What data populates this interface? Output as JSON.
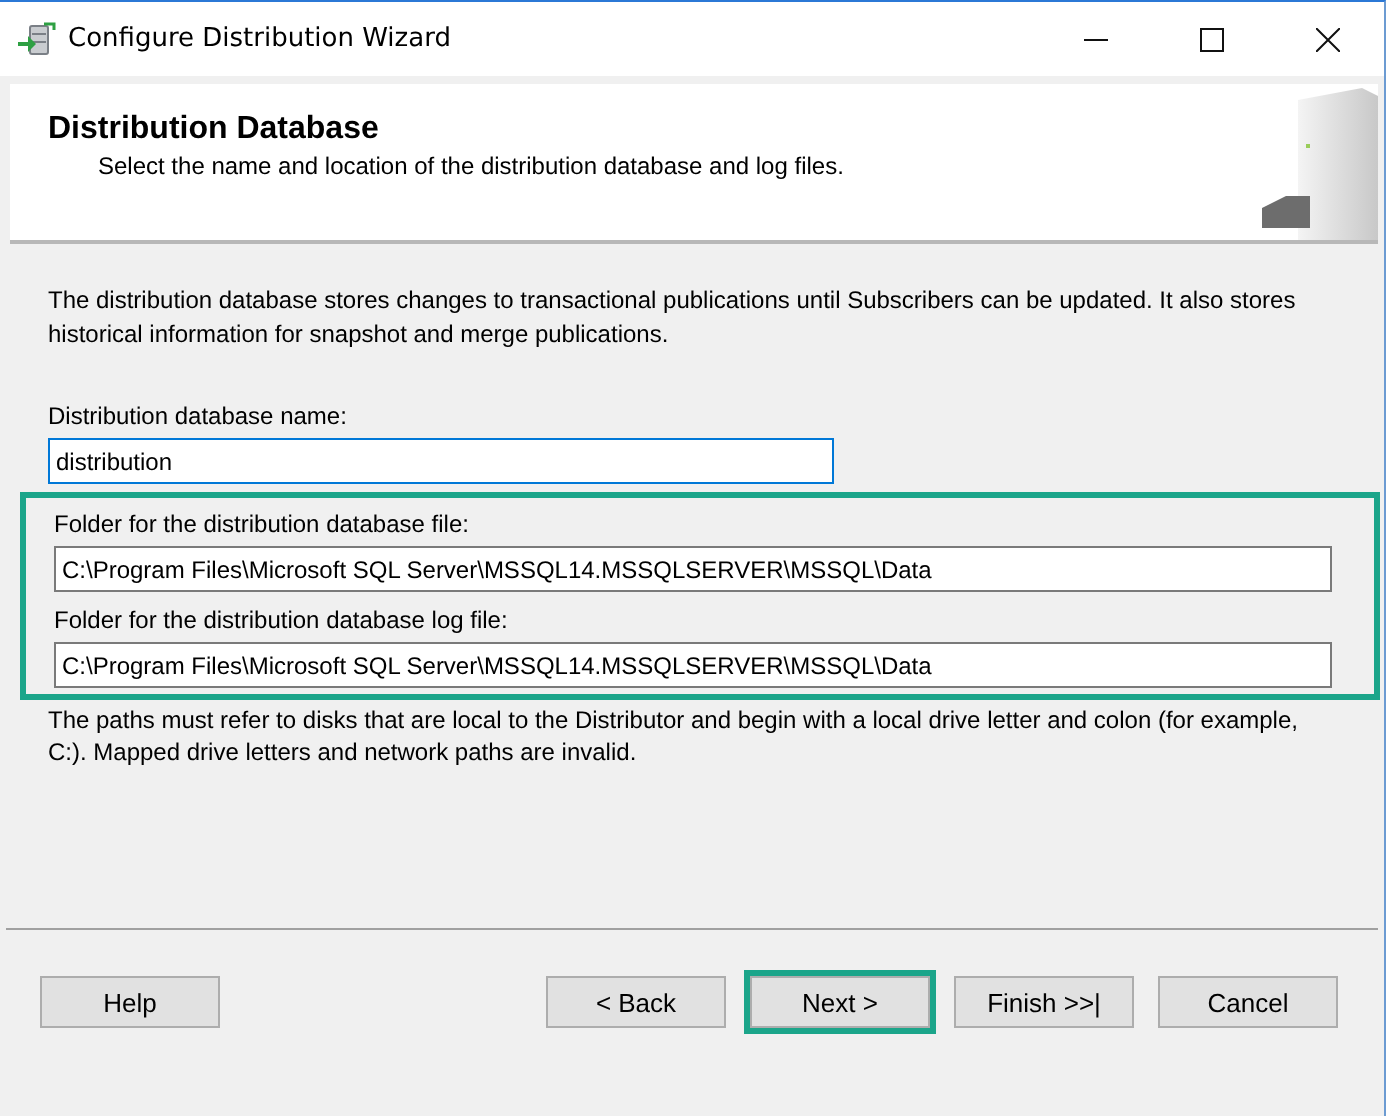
{
  "window": {
    "title": "Configure Distribution Wizard"
  },
  "header": {
    "title": "Distribution Database",
    "subtitle": "Select the name and location of the distribution database and log files."
  },
  "intro": "The distribution database stores changes to transactional publications until Subscribers can be updated. It also stores historical information for snapshot and merge publications.",
  "name_field": {
    "label": "Distribution database name:",
    "value": "distribution",
    "focused": true
  },
  "folders": {
    "highlighted": true,
    "fields": [
      {
        "label": "Folder for the distribution database file:",
        "value": "C:\\Program Files\\Microsoft SQL Server\\MSSQL14.MSSQLSERVER\\MSSQL\\Data"
      },
      {
        "label": "Folder for the distribution database log file:",
        "value": "C:\\Program Files\\Microsoft SQL Server\\MSSQL14.MSSQLSERVER\\MSSQL\\Data"
      }
    ]
  },
  "note": "The paths must refer to disks that are local to the Distributor and begin with a local drive letter and colon (for example, C:). Mapped drive letters and network paths are invalid.",
  "buttons": [
    {
      "label": "Help",
      "kind": "help",
      "highlighted": false
    },
    {
      "label": "< Back",
      "kind": "nav",
      "highlighted": false
    },
    {
      "label": "Next >",
      "kind": "nav",
      "highlighted": true
    },
    {
      "label": "Finish >>|",
      "kind": "nav",
      "highlighted": false
    },
    {
      "label": "Cancel",
      "kind": "nav",
      "highlighted": false
    }
  ]
}
